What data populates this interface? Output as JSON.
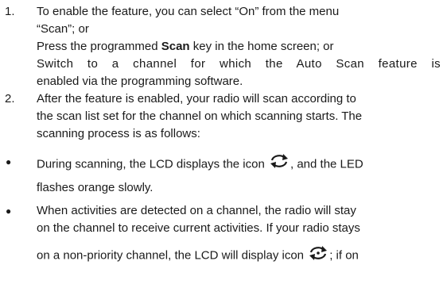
{
  "list": {
    "item1": {
      "number": "1.",
      "p1_line1": "To enable the feature, you can select “On” from the menu",
      "p1_line2": "“Scan”; or",
      "p2_pre": "Press the programmed ",
      "p2_bold": "Scan",
      "p2_post": " key in the home screen; or",
      "p3_line1": "Switch to a channel for which the Auto Scan feature is",
      "p3_line2": "enabled via the programming software."
    },
    "item2": {
      "number": "2.",
      "line1": "After the feature is enabled, your radio will scan according to",
      "line2": "the scan list set for the channel on which scanning starts. The",
      "line3": "scanning process is as follows:"
    },
    "bullet1": {
      "marker": "●",
      "line1_pre": "During scanning, the LCD displays the icon ",
      "line1_post": ", and the LED",
      "line2": "flashes orange slowly.",
      "icon": "scan-icon"
    },
    "bullet2": {
      "marker": "●",
      "line1": "When activities are detected on a channel, the radio will stay",
      "line2": "on the channel to receive current activities. If your radio stays",
      "line3_pre": "on a non-priority channel, the LCD will display icon ",
      "line3_post": "; if on",
      "icon": "non-priority-scan-icon"
    }
  }
}
